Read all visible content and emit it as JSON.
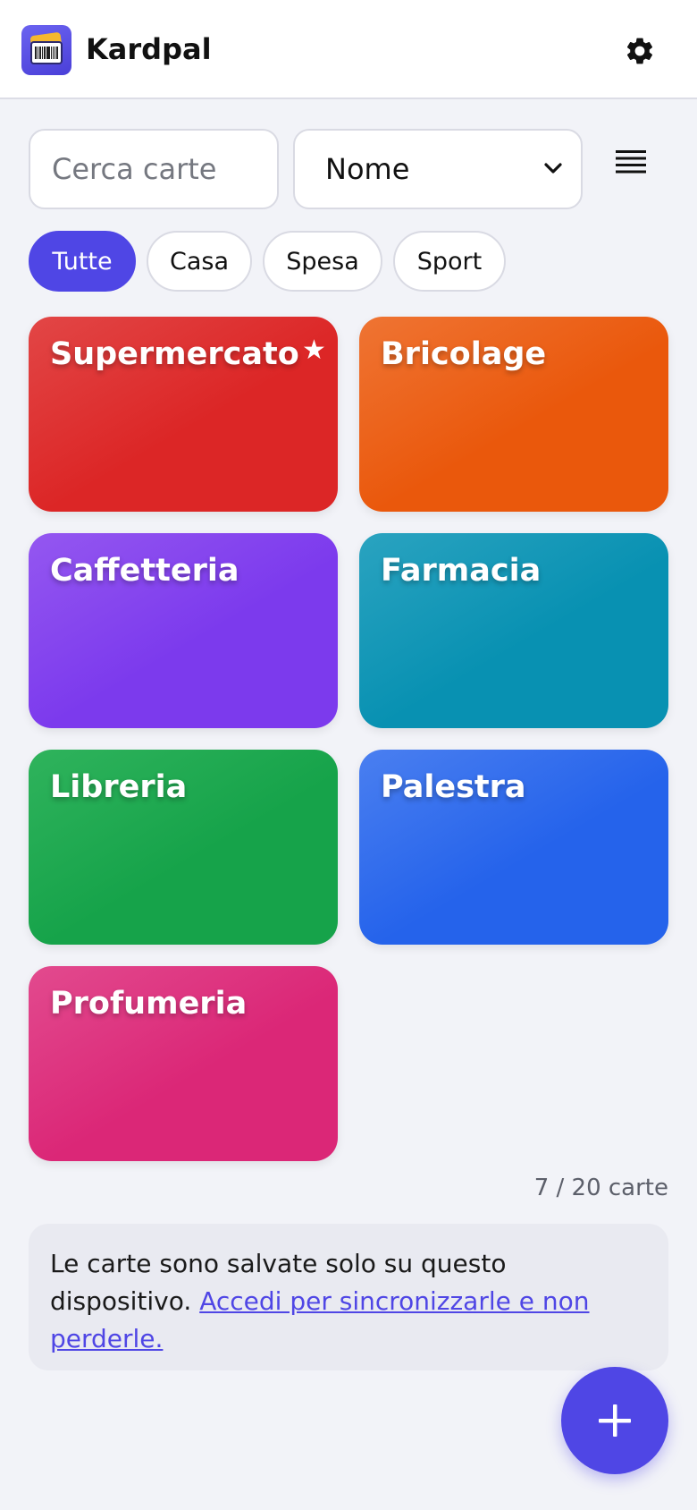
{
  "app": {
    "title": "Kardpal"
  },
  "icons": {
    "logo": "loyalty-card-logo-icon",
    "settings": "gear-icon",
    "view_toggle": "list-view-icon",
    "sort_chevron": "chevron-down-icon",
    "favorite": "star-icon",
    "add": "plus-icon"
  },
  "toolbar": {
    "search_placeholder": "Cerca carte",
    "sort_selected": "Nome"
  },
  "filters": [
    {
      "label": "Tutte",
      "active": true
    },
    {
      "label": "Casa",
      "active": false
    },
    {
      "label": "Spesa",
      "active": false
    },
    {
      "label": "Sport",
      "active": false
    }
  ],
  "cards": [
    {
      "name": "Supermercato",
      "favorite": true,
      "colors": [
        "#e24646",
        "#dc2626"
      ]
    },
    {
      "name": "Bricolage",
      "favorite": false,
      "colors": [
        "#ef7433",
        "#ea580c"
      ]
    },
    {
      "name": "Caffetteria",
      "favorite": false,
      "colors": [
        "#9457f0",
        "#7c3aed"
      ]
    },
    {
      "name": "Farmacia",
      "favorite": false,
      "colors": [
        "#2aa3c0",
        "#0891b2"
      ]
    },
    {
      "name": "Libreria",
      "favorite": false,
      "colors": [
        "#2fb35c",
        "#16a34a"
      ]
    },
    {
      "name": "Palestra",
      "favorite": false,
      "colors": [
        "#4a7ff0",
        "#2563eb"
      ]
    },
    {
      "name": "Profumeria",
      "favorite": false,
      "colors": [
        "#e24a8e",
        "#db2777"
      ]
    }
  ],
  "count_text": "7 / 20 carte",
  "notice": {
    "text": "Le carte sono salvate solo su questo dispositivo. ",
    "link": "Accedi per sincronizzarle e non perderle."
  },
  "colors": {
    "accent": "#4f46e5",
    "background": "#f2f3f8"
  }
}
